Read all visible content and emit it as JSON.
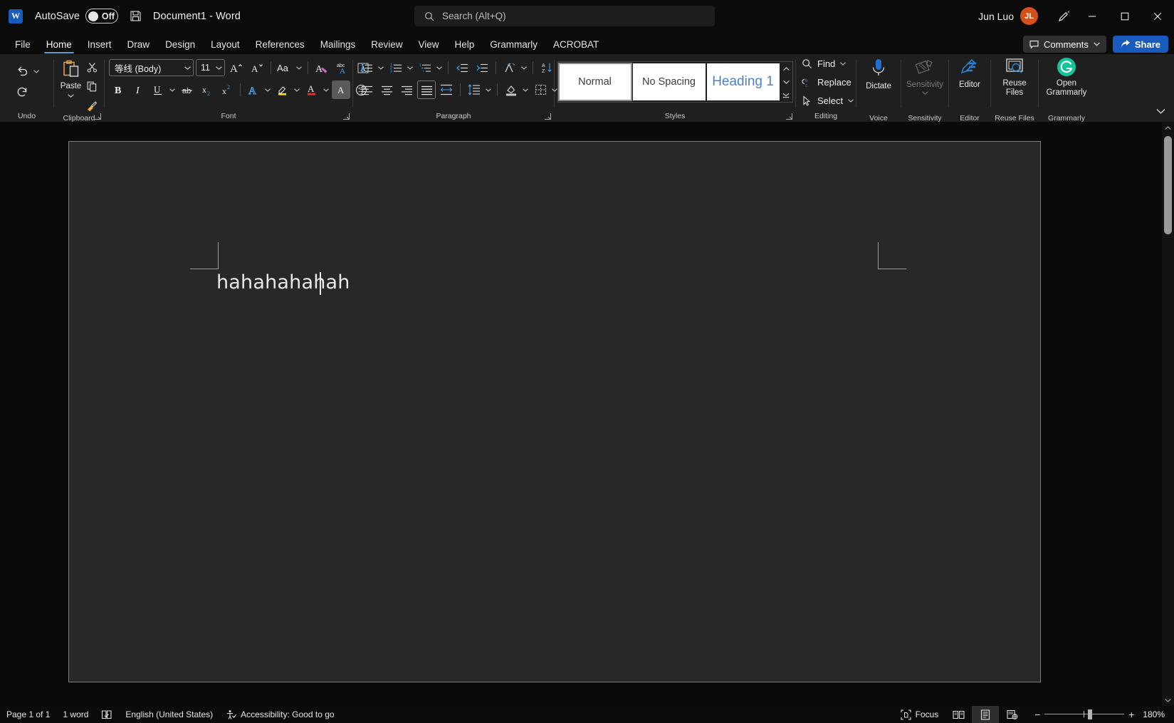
{
  "titlebar": {
    "app_logo": "word-logo",
    "logo_letter": "W",
    "autosave_label": "AutoSave",
    "autosave_state": "Off",
    "save_icon": "save-icon",
    "document_title": "Document1  -  Word",
    "user_name": "Jun Luo",
    "avatar_initials": "JL",
    "pen_icon": "pen-annotate-icon",
    "minimize": "—",
    "maximize": "□",
    "close": "✕"
  },
  "search": {
    "placeholder": "Search (Alt+Q)",
    "icon": "search-icon"
  },
  "tabs": [
    {
      "label": "File",
      "active": false
    },
    {
      "label": "Home",
      "active": true
    },
    {
      "label": "Insert",
      "active": false
    },
    {
      "label": "Draw",
      "active": false
    },
    {
      "label": "Design",
      "active": false
    },
    {
      "label": "Layout",
      "active": false
    },
    {
      "label": "References",
      "active": false
    },
    {
      "label": "Mailings",
      "active": false
    },
    {
      "label": "Review",
      "active": false
    },
    {
      "label": "View",
      "active": false
    },
    {
      "label": "Help",
      "active": false
    },
    {
      "label": "Grammarly",
      "active": false
    },
    {
      "label": "ACROBAT",
      "active": false
    }
  ],
  "tab_right": {
    "comments_label": "Comments",
    "comments_icon": "comment-icon",
    "share_label": "Share",
    "share_icon": "share-icon"
  },
  "ribbon": {
    "groups": {
      "undo": {
        "label": "Undo",
        "undo_icon": "undo-arrow-icon",
        "redo_icon": "redo-arrow-icon"
      },
      "clipboard": {
        "label": "Clipboard",
        "paste_label": "Paste",
        "paste_icon": "paste-clipboard-icon",
        "cut_icon": "scissors-icon",
        "copy_icon": "copy-icon",
        "format_painter_icon": "format-painter-icon"
      },
      "font": {
        "label": "Font",
        "font_name": "等线 (Body)",
        "font_size": "11",
        "grow_font_icon": "grow-font-icon",
        "shrink_font_icon": "shrink-font-icon",
        "change_case_icon": "change-case-icon",
        "clear_formatting_icon": "clear-formatting-icon",
        "phonetic_guide_icon": "phonetic-guide-icon",
        "character_border_icon": "character-border-icon",
        "bold_icon": "bold-icon",
        "italic_icon": "italic-icon",
        "underline_icon": "underline-icon",
        "strikethrough_icon": "strikethrough-icon",
        "subscript_icon": "subscript-icon",
        "superscript_icon": "superscript-icon",
        "text_effects_icon": "text-effects-icon",
        "highlight_icon": "text-highlight-color-icon",
        "font_color_icon": "font-color-icon",
        "character_shading_icon": "character-shading-icon",
        "enclose_characters_icon": "enclose-characters-icon"
      },
      "paragraph": {
        "label": "Paragraph",
        "bullets_icon": "bullets-icon",
        "numbering_icon": "numbering-icon",
        "multilevel_icon": "multilevel-list-icon",
        "decrease_indent_icon": "decrease-indent-icon",
        "increase_indent_icon": "increase-indent-icon",
        "asian_layout_icon": "asian-layout-icon",
        "sort_icon": "sort-icon",
        "show_marks_icon": "show-formatting-marks-icon",
        "align_left_icon": "align-left-icon",
        "align_center_icon": "align-center-icon",
        "align_right_icon": "align-right-icon",
        "justify_icon": "justify-icon",
        "distributed_icon": "distributed-icon",
        "line_spacing_icon": "line-spacing-icon",
        "shading_icon": "shading-icon",
        "borders_icon": "borders-icon"
      },
      "styles": {
        "label": "Styles",
        "cards": [
          {
            "name": "Normal",
            "selected": true
          },
          {
            "name": "No Spacing",
            "selected": false
          },
          {
            "name": "Heading 1",
            "selected": false
          }
        ]
      },
      "editing": {
        "label": "Editing",
        "find_label": "Find",
        "find_icon": "find-magnifier-icon",
        "replace_label": "Replace",
        "replace_icon": "replace-icon",
        "select_label": "Select",
        "select_icon": "select-cursor-icon"
      },
      "voice": {
        "label": "Voice",
        "dictate_label": "Dictate",
        "dictate_icon": "microphone-icon"
      },
      "sensitivity": {
        "label": "Sensitivity",
        "button_label": "Sensitivity",
        "icon": "sensitivity-label-icon",
        "disabled": true
      },
      "editor": {
        "label": "Editor",
        "button_label": "Editor",
        "icon": "editor-pen-icon"
      },
      "reuse_files": {
        "label": "Reuse Files",
        "button_label": "Reuse\nFiles",
        "line1": "Reuse",
        "line2": "Files",
        "icon": "reuse-files-icon"
      },
      "grammarly": {
        "label": "Grammarly",
        "line1": "Open",
        "line2": "Grammarly",
        "icon": "grammarly-g-icon"
      }
    },
    "collapse_icon": "chevron-down-icon"
  },
  "document": {
    "body_text": "hahahahahah",
    "page_background": "#282828"
  },
  "statusbar": {
    "page_info": "Page 1 of 1",
    "word_count": "1 word",
    "proofing_icon": "proofing-errors-icon",
    "language": "English (United States)",
    "accessibility_icon": "accessibility-icon",
    "accessibility": "Accessibility: Good to go",
    "focus_label": "Focus",
    "focus_icon": "focus-mode-icon",
    "read_mode_icon": "read-mode-icon",
    "print_layout_icon": "print-layout-icon",
    "web_layout_icon": "web-layout-icon",
    "zoom_out_icon": "zoom-out-icon",
    "zoom_in_icon": "zoom-in-icon",
    "zoom_level": "180%"
  },
  "colors": {
    "accent_blue": "#185abd",
    "avatar_orange": "#d3501a",
    "ribbon_bg": "#1f1f1f",
    "titlebar_bg": "#0b0b0b",
    "page_bg": "#282828",
    "grammarly_green": "#15c39a"
  }
}
